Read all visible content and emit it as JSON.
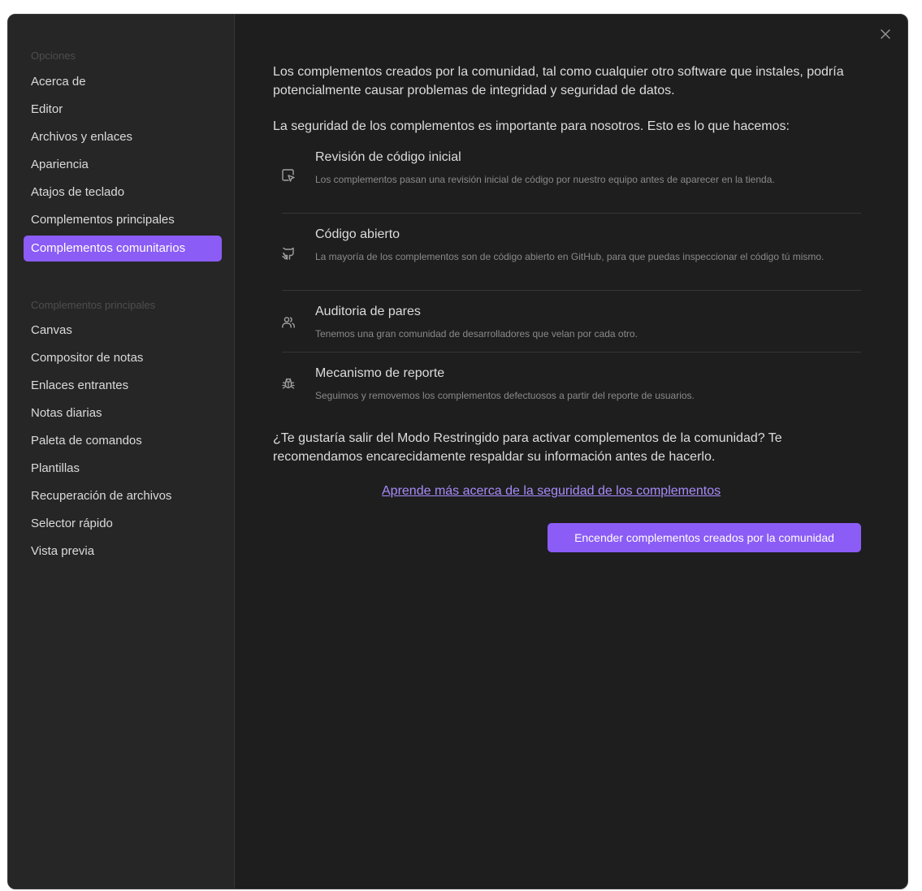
{
  "sidebar": {
    "options_heading": "Opciones",
    "options_items": [
      {
        "label": "Acerca de"
      },
      {
        "label": "Editor"
      },
      {
        "label": "Archivos y enlaces"
      },
      {
        "label": "Apariencia"
      },
      {
        "label": "Atajos de teclado"
      },
      {
        "label": "Complementos principales"
      },
      {
        "label": "Complementos comunitarios",
        "active": true
      }
    ],
    "core_heading": "Complementos principales",
    "core_items": [
      {
        "label": "Canvas"
      },
      {
        "label": "Compositor de notas"
      },
      {
        "label": "Enlaces entrantes"
      },
      {
        "label": "Notas diarias"
      },
      {
        "label": "Paleta de comandos"
      },
      {
        "label": "Plantillas"
      },
      {
        "label": "Recuperación de archivos"
      },
      {
        "label": "Selector rápido"
      },
      {
        "label": "Vista previa"
      }
    ]
  },
  "close_icon": "close-icon",
  "main": {
    "intro": "Los complementos creados por la comunidad, tal como cualquier otro software que instales, podría potencialmente causar problemas de integridad y seguridad de datos.",
    "security_lead": "La seguridad de los complementos es importante para nosotros. Esto es lo que hacemos:",
    "features": [
      {
        "icon": "code-review-icon",
        "title": "Revisión de código inicial",
        "description": "Los complementos pasan una revisión inicial de código por nuestro equipo antes de aparecer en la tienda."
      },
      {
        "icon": "github-icon",
        "title": "Código abierto",
        "description": "La mayoría de los complementos son de código abierto en GitHub, para que puedas inspeccionar el código tú mismo."
      },
      {
        "icon": "users-icon",
        "title": "Auditoria de pares",
        "description": "Tenemos una gran comunidad de desarrolladores que velan por cada otro."
      },
      {
        "icon": "bug-icon",
        "title": "Mecanismo de reporte",
        "description": "Seguimos y removemos los complementos defectuosos a partir del reporte de usuarios."
      }
    ],
    "question": "¿Te gustaría salir del Modo Restringido para activar complementos de la comunidad? Te recomendamos encarecidamente respaldar su información antes de hacerlo.",
    "learn_more_link": "Aprende más acerca de la seguridad de los complementos",
    "enable_button": "Encender complementos creados por la comunidad"
  },
  "colors": {
    "accent": "#8b5cf6",
    "link": "#a78bfa",
    "background": "#1e1e1e",
    "sidebar_background": "#262626"
  }
}
